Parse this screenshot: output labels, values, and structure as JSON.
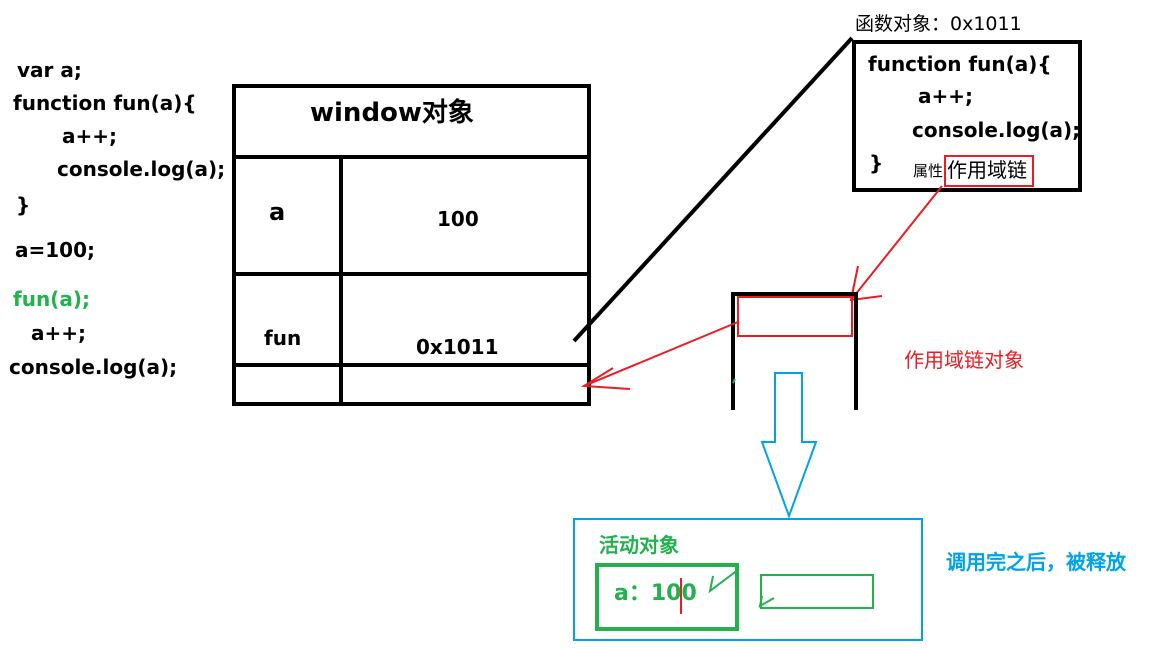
{
  "code_left": {
    "line1": "var a;",
    "line2": "function fun(a){",
    "line3": "a++;",
    "line4": "console.log(a);",
    "line5": "}",
    "line6": "a=100;",
    "line7": "fun(a);",
    "line8": "a++;",
    "line9": "console.log(a);"
  },
  "window_table": {
    "title": "window对象",
    "row1_key": "a",
    "row1_value": "100",
    "row2_key": "fun",
    "row2_value": "0x1011"
  },
  "function_object": {
    "header": "函数对象：0x1011",
    "line1": "function fun(a){",
    "line2": "a++;",
    "line3": "console.log(a);",
    "line4": "}",
    "attr_label": "属性",
    "scope_chain_label": "作用域链"
  },
  "labels": {
    "scope_chain_object": "作用域链对象",
    "activation_object": "活动对象",
    "activation_value": "a：100",
    "released_note": "调用完之后，被释放"
  },
  "colors": {
    "black": "#000000",
    "red": "#ed1c24",
    "green": "#22b14c",
    "blue": "#00a2e8"
  }
}
